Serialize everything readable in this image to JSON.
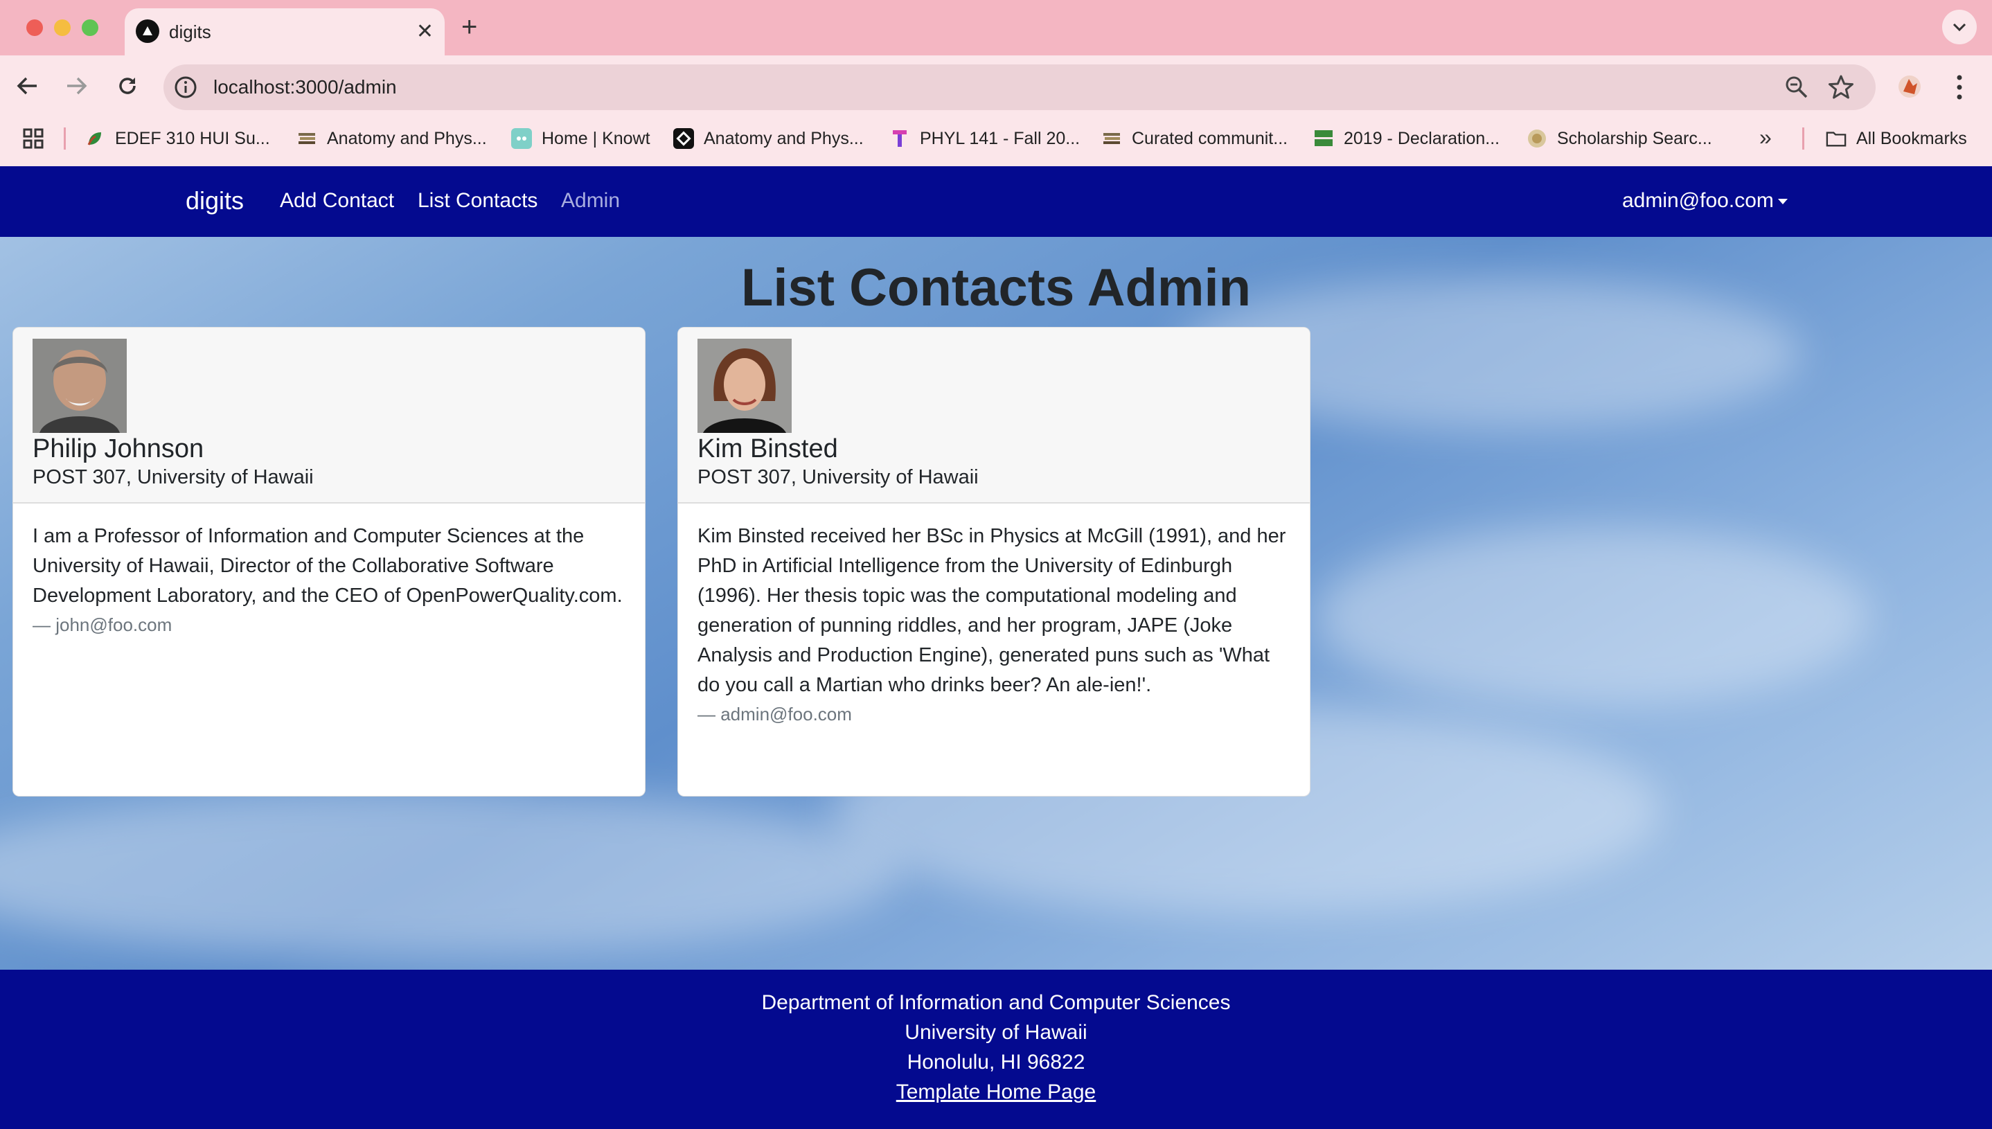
{
  "browser": {
    "tab_title": "digits",
    "url": "localhost:3000/admin",
    "bookmarks": [
      "EDEF 310 HUI Su...",
      "Anatomy and Phys...",
      "Home | Knowt",
      "Anatomy and Phys...",
      "PHYL 141 - Fall 20...",
      "Curated communit...",
      "2019 - Declaration...",
      "Scholarship Searc..."
    ],
    "more_bookmarks": "»",
    "all_bookmarks": "All Bookmarks"
  },
  "navbar": {
    "brand": "digits",
    "links": [
      "Add Contact",
      "List Contacts",
      "Admin"
    ],
    "user": "admin@foo.com"
  },
  "main": {
    "title": "List Contacts Admin",
    "contacts": [
      {
        "name": "Philip Johnson",
        "address": "POST 307, University of Hawaii",
        "description": "I am a Professor of Information and Computer Sciences at the University of Hawaii, Director of the Collaborative Software Development Laboratory, and the CEO of OpenPowerQuality.com.",
        "owner": "— john@foo.com"
      },
      {
        "name": "Kim Binsted",
        "address": "POST 307, University of Hawaii",
        "description": "Kim Binsted received her BSc in Physics at McGill (1991), and her PhD in Artificial Intelligence from the University of Edinburgh (1996). Her thesis topic was the computational modeling and generation of punning riddles, and her program, JAPE (Joke Analysis and Production Engine), generated puns such as 'What do you call a Martian who drinks beer? An ale-ien!'.",
        "owner": "— admin@foo.com"
      }
    ]
  },
  "footer": {
    "line1": "Department of Information and Computer Sciences",
    "line2": "University of Hawaii",
    "line3": "Honolulu, HI 96822",
    "link": "Template Home Page"
  },
  "colors": {
    "navbar_bg": "#040a8f",
    "chrome_tabbar": "#f4b6c2",
    "chrome_toolbar": "#fbe6ea"
  }
}
